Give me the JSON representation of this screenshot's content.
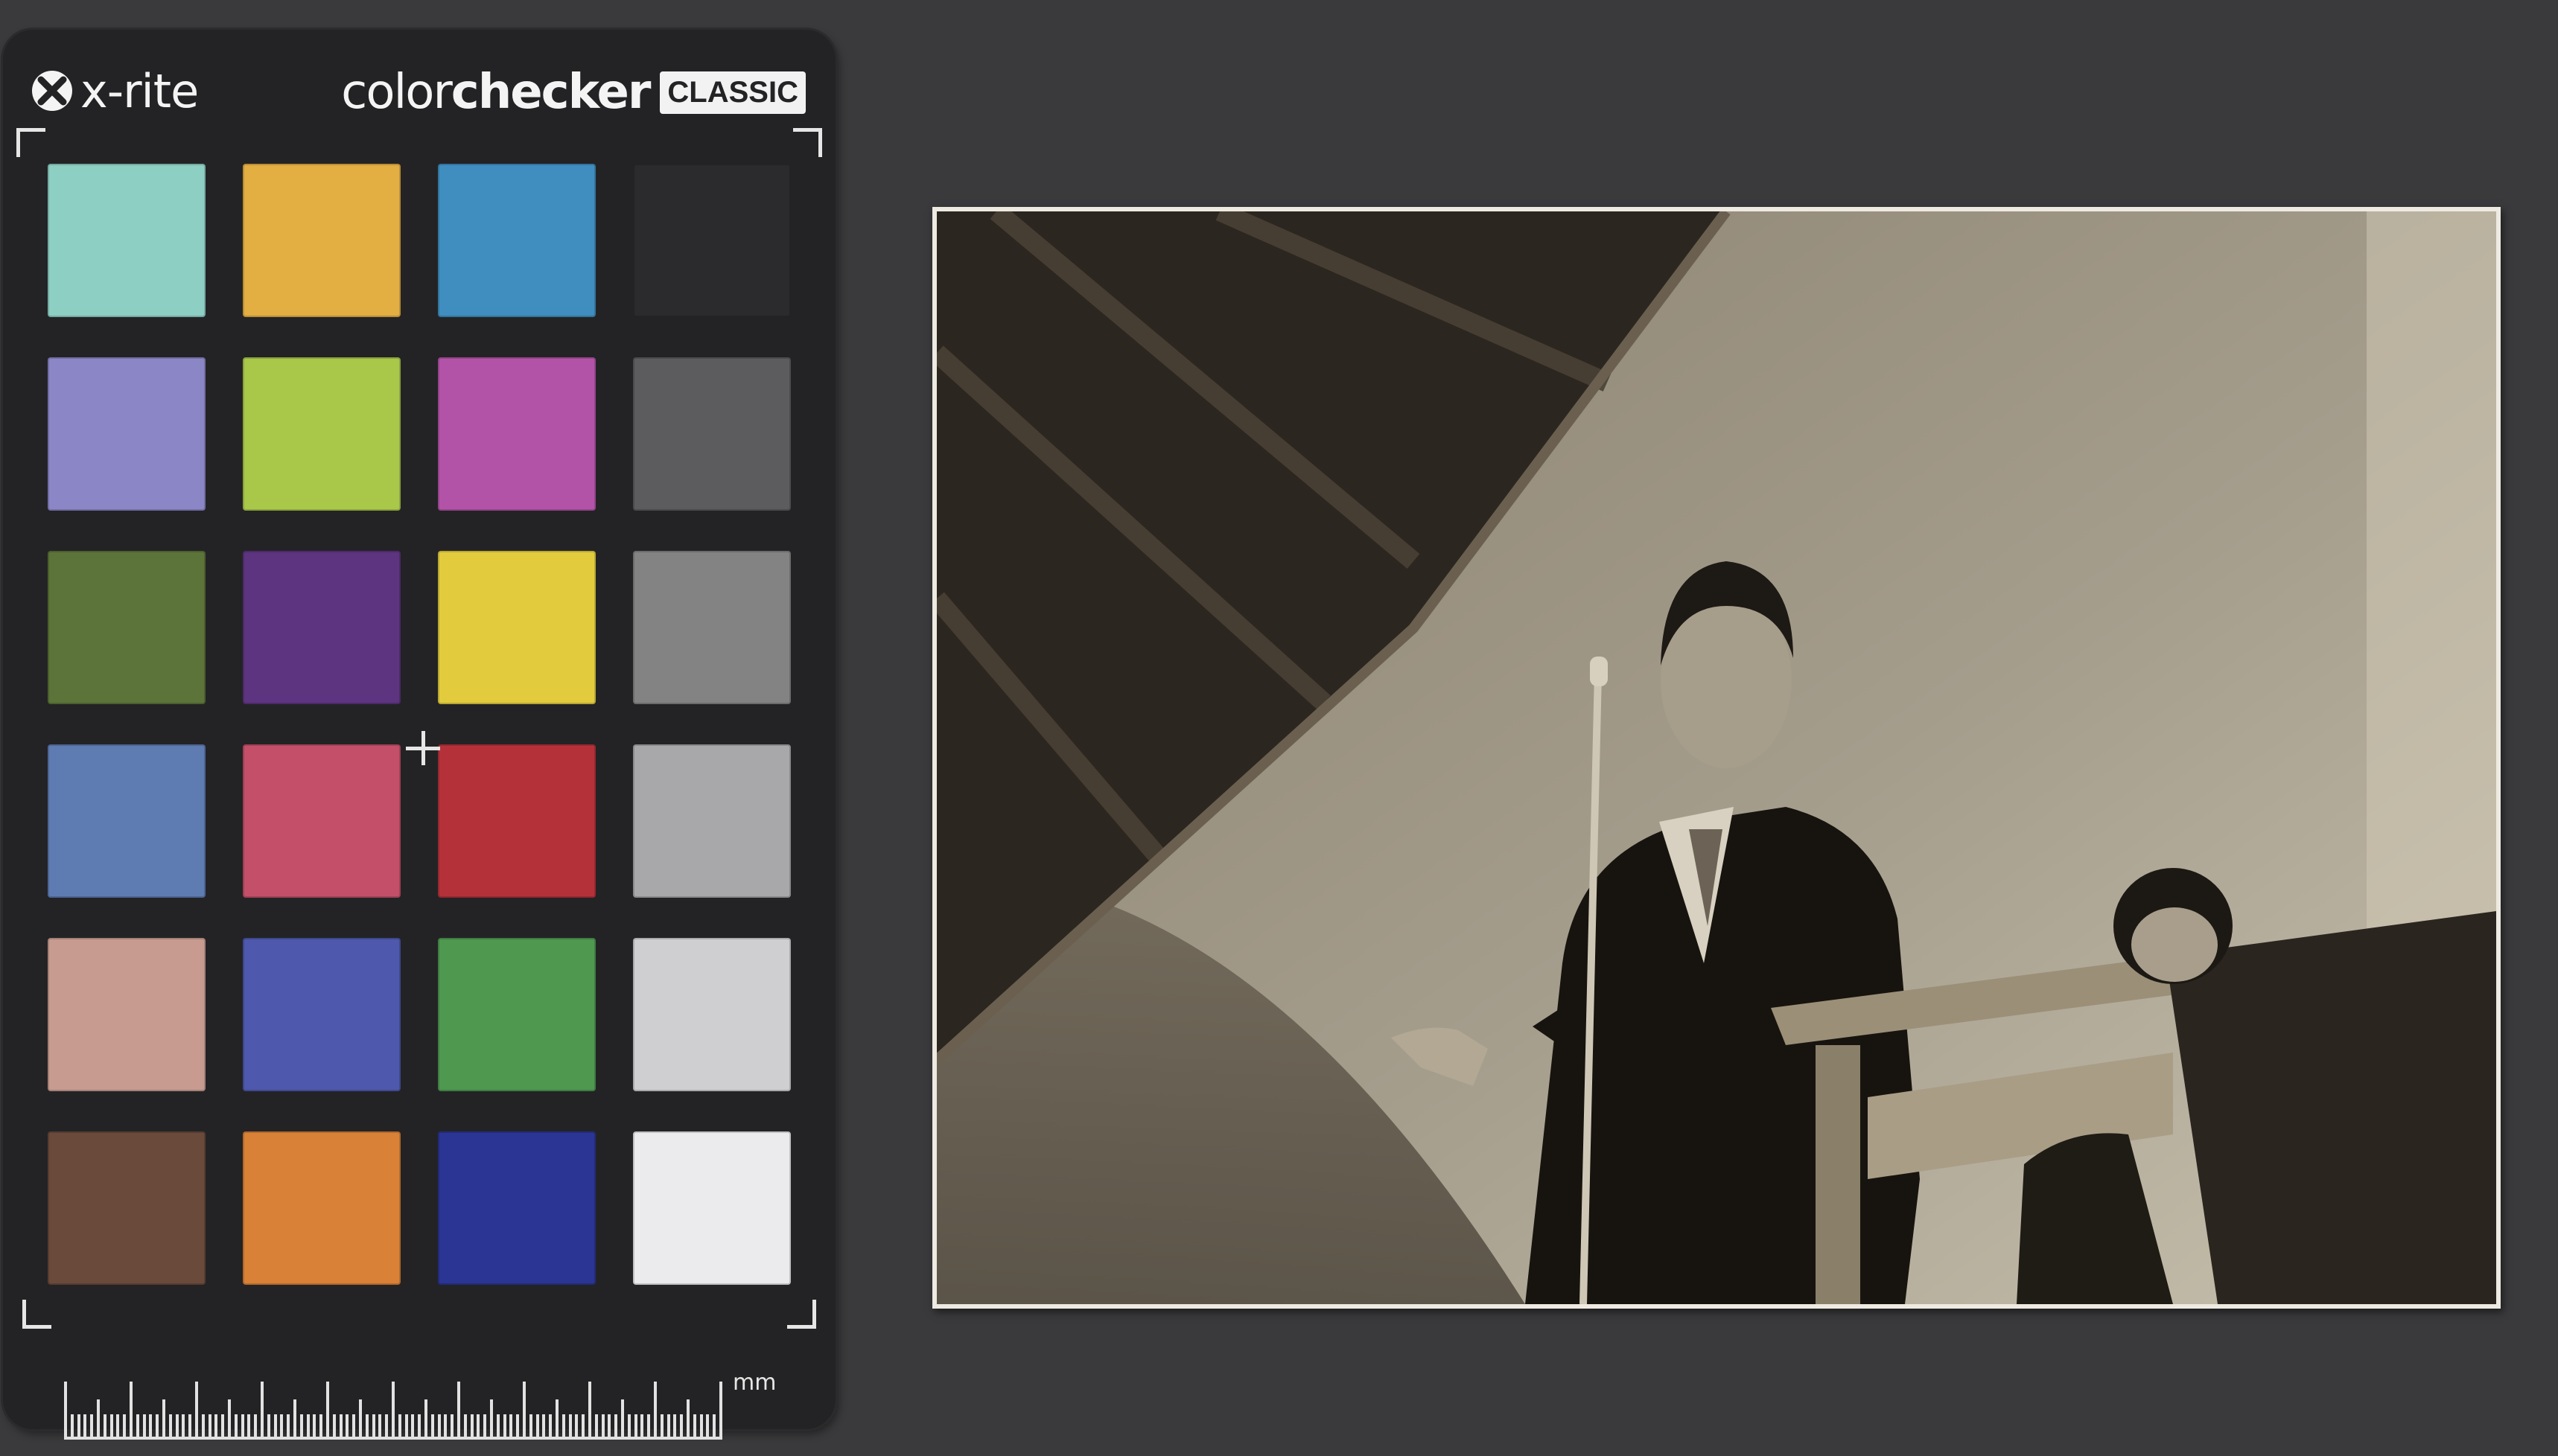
{
  "card": {
    "brand": "x-rite",
    "product_light": "color",
    "product_bold": "checker",
    "product_badge": "CLASSIC",
    "ruler_unit": "mm",
    "center_mark_icon": "crosshair-icon",
    "logo_icon": "xrite-x-logo-icon",
    "patch_colors": [
      [
        "#8ecfc4",
        "#e3ae42",
        "#3f8ebf",
        "#2b2b2d"
      ],
      [
        "#8b86c6",
        "#a9c84a",
        "#b253a8",
        "#5c5c5e"
      ],
      [
        "#5c7439",
        "#5d347f",
        "#e2cc3e",
        "#838384"
      ],
      [
        "#5e7bb2",
        "#c44f68",
        "#b5313a",
        "#a8a8aa"
      ],
      [
        "#c79b90",
        "#4e58ac",
        "#4e9850",
        "#cfcfd1"
      ],
      [
        "#6a4a3b",
        "#d98136",
        "#2b3594",
        "#ebebed"
      ]
    ]
  },
  "photo": {
    "subject": "black-and-white-photo-speaker-at-microphone"
  }
}
